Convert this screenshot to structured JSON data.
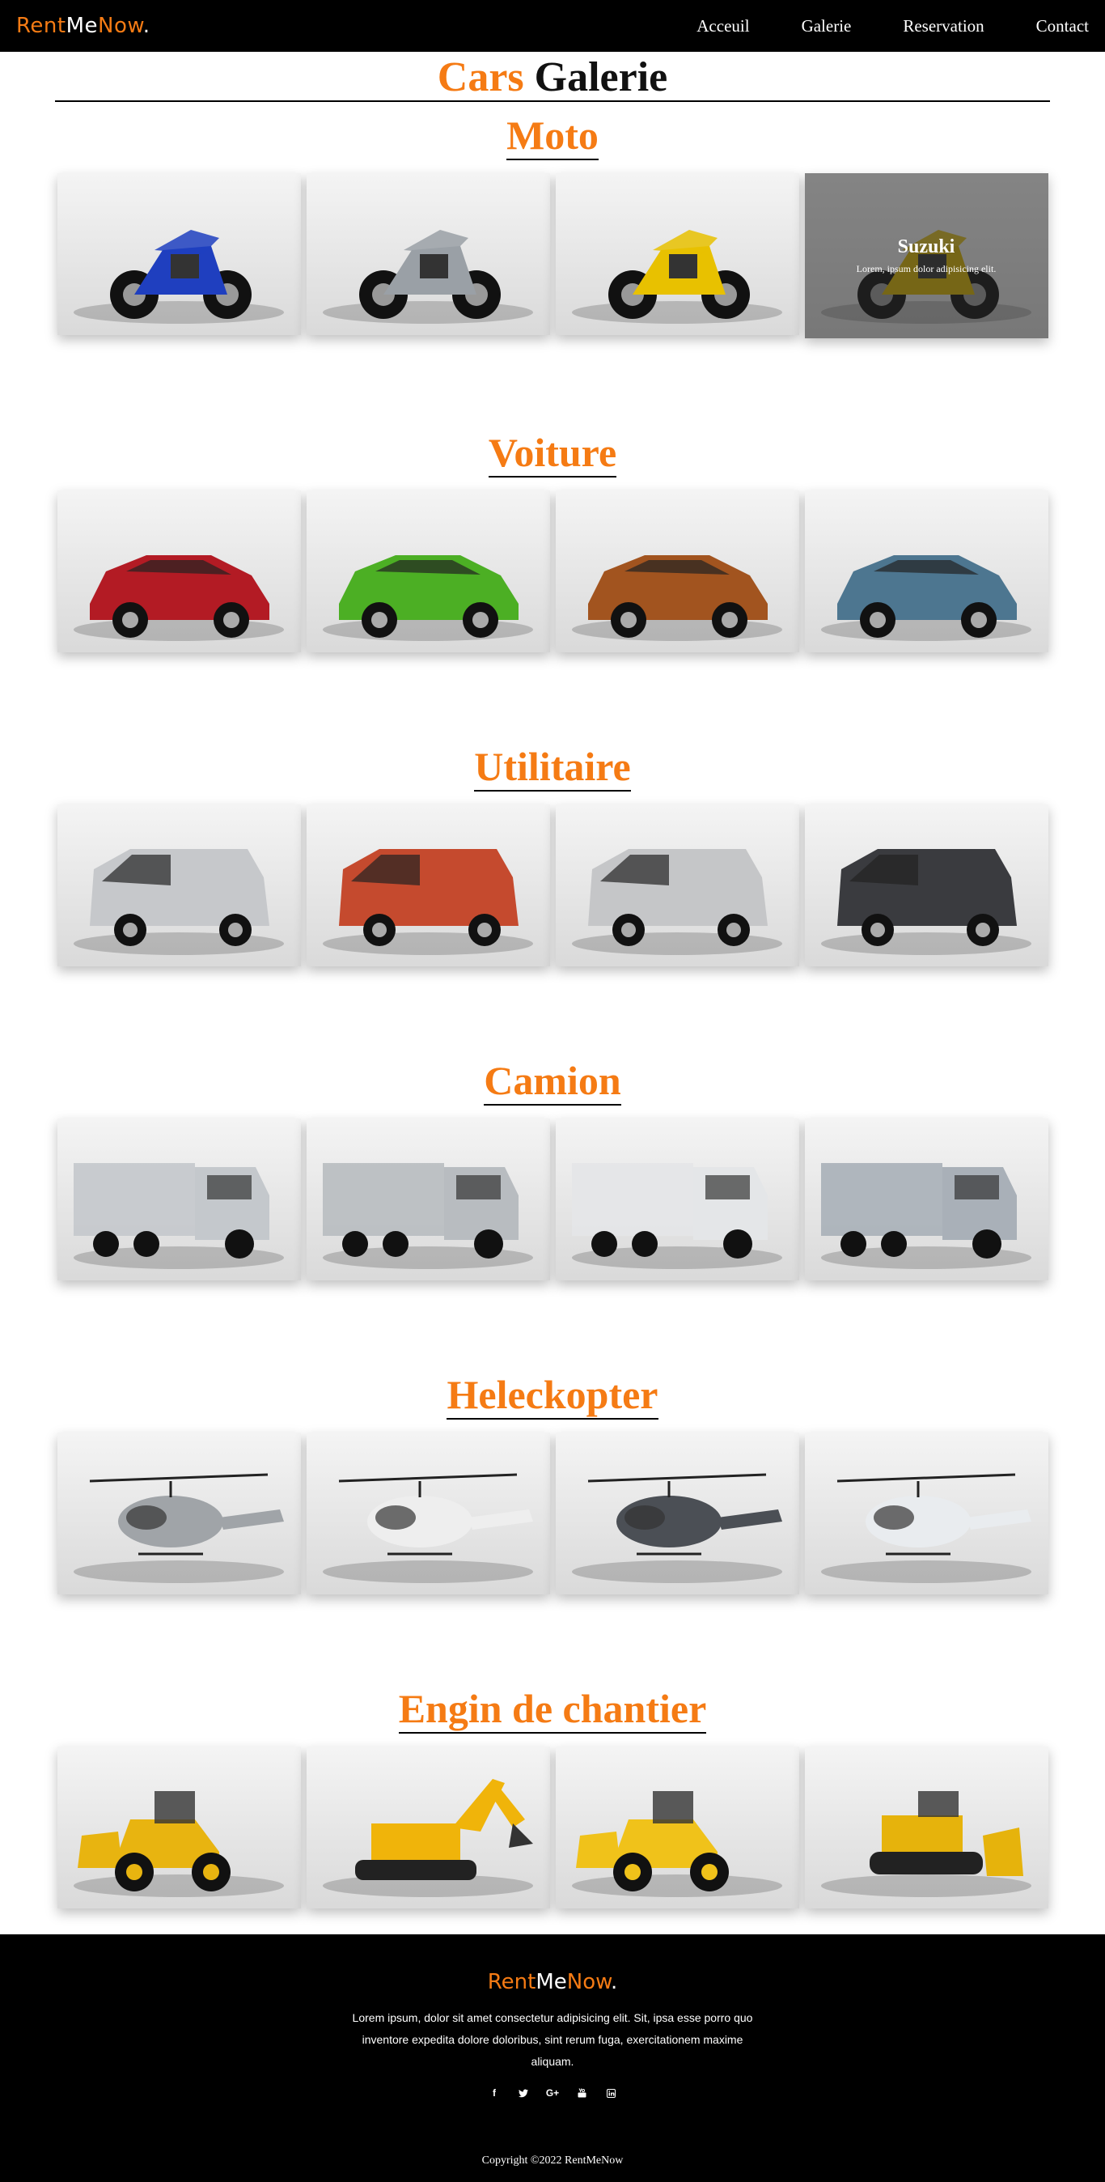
{
  "brand": {
    "part1": "Rent",
    "part2": "Me",
    "part3": "Now",
    "dot": "."
  },
  "nav": {
    "items": [
      "Acceuil",
      "Galerie",
      "Reservation",
      "Contact"
    ]
  },
  "page_title": {
    "accent": "Cars",
    "rest": "Galerie"
  },
  "sections": [
    {
      "title": "Moto",
      "tiles": [
        {
          "scene": "blue-sport-motorcycle-on-light-background",
          "icon": "motorcycle"
        },
        {
          "scene": "black-silver-motorcycle-on-dark-background",
          "icon": "motorcycle"
        },
        {
          "scene": "yellow-sport-motorcycle-in-studio",
          "icon": "motorcycle"
        },
        {
          "scene": "yellow-motorcycle-hovered",
          "icon": "motorcycle"
        }
      ]
    },
    {
      "title": "Voiture",
      "tiles": [
        {
          "scene": "red-suv-on-white",
          "icon": "car"
        },
        {
          "scene": "green-supercar-on-dark",
          "icon": "car"
        },
        {
          "scene": "orange-suv-on-grey",
          "icon": "car"
        },
        {
          "scene": "blue-crossover-on-grey",
          "icon": "car"
        }
      ]
    },
    {
      "title": "Utilitaire",
      "tiles": [
        {
          "scene": "silver-van-charging",
          "icon": "van"
        },
        {
          "scene": "red-van-on-road",
          "icon": "van"
        },
        {
          "scene": "silver-minivan",
          "icon": "van"
        },
        {
          "scene": "dark-van-on-light-grid",
          "icon": "van"
        }
      ]
    },
    {
      "title": "Camion",
      "tiles": [
        {
          "scene": "silver-volvo-truck",
          "icon": "truck"
        },
        {
          "scene": "silver-truck-on-forest-road",
          "icon": "truck"
        },
        {
          "scene": "white-electric-semi",
          "icon": "truck"
        },
        {
          "scene": "silver-truck-on-highway",
          "icon": "truck"
        }
      ]
    },
    {
      "title": "Heleckopter",
      "tiles": [
        {
          "scene": "silver-helicopter-on-dark",
          "icon": "helicopter"
        },
        {
          "scene": "white-helicopter-on-tarmac",
          "icon": "helicopter"
        },
        {
          "scene": "grey-military-helicopter",
          "icon": "helicopter"
        },
        {
          "scene": "white-helicopter-over-sea",
          "icon": "helicopter"
        }
      ]
    },
    {
      "title": "Engin de chantier",
      "tiles": [
        {
          "scene": "yellow-wheel-loader-on-dirt",
          "icon": "loader"
        },
        {
          "scene": "yellow-excavator-on-gravel",
          "icon": "excavator"
        },
        {
          "scene": "yellow-loader-close-up",
          "icon": "loader"
        },
        {
          "scene": "yellow-bulldozer-aerial",
          "icon": "bulldozer"
        }
      ]
    }
  ],
  "hover_caption": {
    "title": "Suzuki",
    "text": "Lorem, ipsum dolor adipisicing elit."
  },
  "footer": {
    "text": "Lorem ipsum, dolor sit amet consectetur adipisicing elit. Sit, ipsa esse porro quo inventore expedita dolore doloribus, sint rerum fuga, exercitationem maxime aliquam.",
    "socials": [
      "facebook-icon",
      "twitter-icon",
      "google-plus-icon",
      "youtube-icon",
      "linkedin-icon"
    ],
    "copyright": "Copyright  ©2022  RentMeNow"
  },
  "colors": {
    "accent": "#f57b14",
    "nav_bg": "#000000",
    "footer_bg": "#000000"
  }
}
